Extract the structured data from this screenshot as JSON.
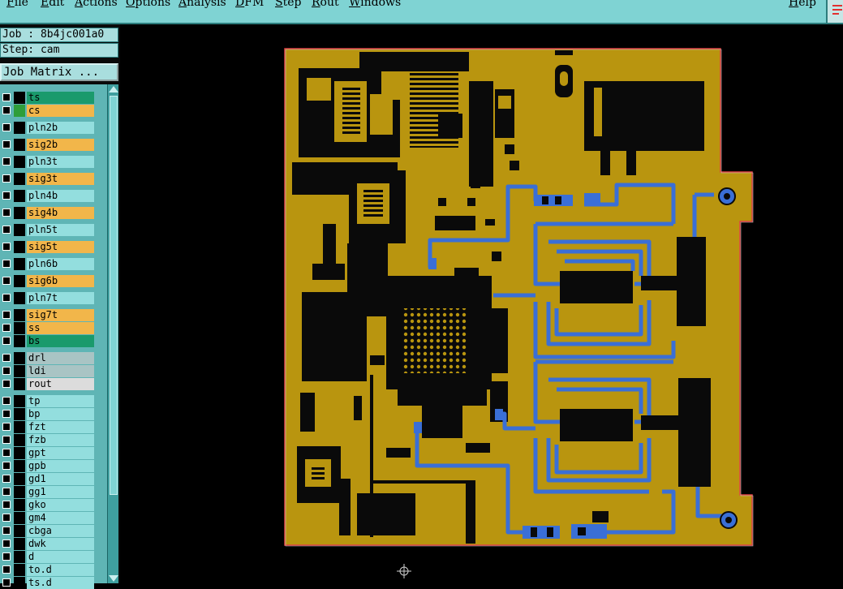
{
  "menubar": {
    "items": [
      "File",
      "Edit",
      "Actions",
      "Options",
      "Analysis",
      "DFM",
      "Step",
      "Rout",
      "Windows"
    ],
    "help": "Help"
  },
  "left_panel": {
    "job_label": "Job : 8b4jc001a0",
    "step_label": "Step: cam",
    "job_matrix_button": "Job Matrix ..."
  },
  "layers": [
    {
      "name": "ts",
      "color": "#1a9a6c",
      "swatch": "#000000"
    },
    {
      "name": "cs",
      "color": "#f2b64a",
      "swatch": "#2e9e3a"
    },
    {
      "name": "pln2b",
      "color": "#93dede",
      "swatch": "#000000"
    },
    {
      "name": "sig2b",
      "color": "#f2b64a",
      "swatch": "#000000"
    },
    {
      "name": "pln3t",
      "color": "#93dede",
      "swatch": "#000000"
    },
    {
      "name": "sig3t",
      "color": "#f2b64a",
      "swatch": "#000000"
    },
    {
      "name": "pln4b",
      "color": "#93dede",
      "swatch": "#000000"
    },
    {
      "name": "sig4b",
      "color": "#f2b64a",
      "swatch": "#000000"
    },
    {
      "name": "pln5t",
      "color": "#93dede",
      "swatch": "#000000"
    },
    {
      "name": "sig5t",
      "color": "#f2b64a",
      "swatch": "#000000"
    },
    {
      "name": "pln6b",
      "color": "#93dede",
      "swatch": "#000000"
    },
    {
      "name": "sig6b",
      "color": "#f2b64a",
      "swatch": "#000000"
    },
    {
      "name": "pln7t",
      "color": "#93dede",
      "swatch": "#000000"
    },
    {
      "name": "sig7t",
      "color": "#f2b64a",
      "swatch": "#000000"
    },
    {
      "name": "ss",
      "color": "#f2b64a",
      "swatch": "#000000"
    },
    {
      "name": "bs",
      "color": "#1a9a6c",
      "swatch": "#000000"
    },
    {
      "name": "drl",
      "color": "#a9c4c4",
      "swatch": "#000000"
    },
    {
      "name": "ldi",
      "color": "#a9c4c4",
      "swatch": "#000000"
    },
    {
      "name": "rout",
      "color": "#dcdcdc",
      "swatch": "#000000"
    },
    {
      "name": "tp",
      "color": "#93dede",
      "swatch": "#000000"
    },
    {
      "name": "bp",
      "color": "#93dede",
      "swatch": "#000000"
    },
    {
      "name": "fzt",
      "color": "#93dede",
      "swatch": "#000000"
    },
    {
      "name": "fzb",
      "color": "#93dede",
      "swatch": "#000000"
    },
    {
      "name": "gpt",
      "color": "#93dede",
      "swatch": "#000000"
    },
    {
      "name": "gpb",
      "color": "#93dede",
      "swatch": "#000000"
    },
    {
      "name": "gd1",
      "color": "#93dede",
      "swatch": "#000000"
    },
    {
      "name": "gg1",
      "color": "#93dede",
      "swatch": "#000000"
    },
    {
      "name": "gko",
      "color": "#93dede",
      "swatch": "#000000"
    },
    {
      "name": "gm4",
      "color": "#93dede",
      "swatch": "#000000"
    },
    {
      "name": "cbga",
      "color": "#93dede",
      "swatch": "#000000"
    },
    {
      "name": "dwk",
      "color": "#93dede",
      "swatch": "#000000"
    },
    {
      "name": "d",
      "color": "#93dede",
      "swatch": "#000000"
    },
    {
      "name": "to.d",
      "color": "#93dede",
      "swatch": "#000000"
    },
    {
      "name": "ts.d",
      "color": "#93dede",
      "swatch": "#000000"
    }
  ],
  "colors": {
    "board_copper": "#b9950f",
    "board_outline": "#e24040",
    "trace_black": "#0a0a0a",
    "trace_blue": "#3a6fd6",
    "menubar_bg": "#7fd3d3"
  }
}
